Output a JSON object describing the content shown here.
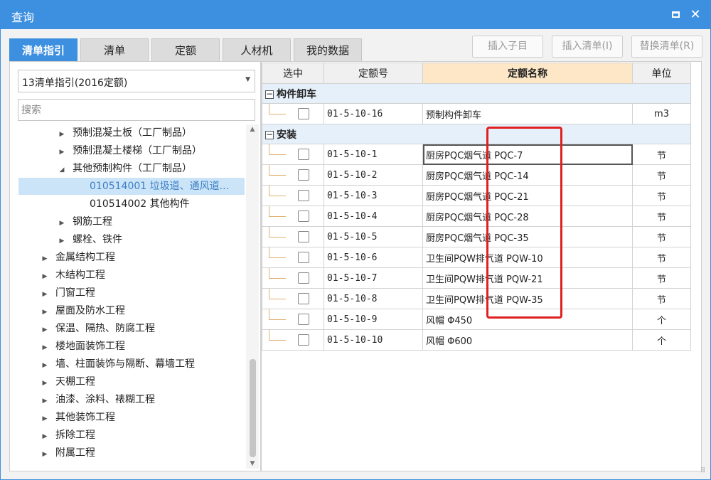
{
  "window": {
    "title": "查询"
  },
  "tabs": [
    {
      "label": "清单指引",
      "active": true
    },
    {
      "label": "清单",
      "active": false
    },
    {
      "label": "定额",
      "active": false
    },
    {
      "label": "人材机",
      "active": false
    },
    {
      "label": "我的数据",
      "active": false
    }
  ],
  "toolbar": {
    "insert_child": "插入子目",
    "insert_list": "插入清单(I)",
    "replace_list": "替换清单(R)"
  },
  "left": {
    "dropdown_value": "13清单指引(2016定额)",
    "search_placeholder": "搜索",
    "tree": [
      {
        "label": "预制混凝土板（工厂制品）",
        "level": 1,
        "expanded": false
      },
      {
        "label": "预制混凝土楼梯（工厂制品）",
        "level": 1,
        "expanded": false
      },
      {
        "label": "其他预制构件（工厂制品）",
        "level": 1,
        "expanded": true
      },
      {
        "label": "010514001  垃圾道、通风道...",
        "level": 2,
        "selected": true
      },
      {
        "label": "010514002  其他构件",
        "level": 2
      },
      {
        "label": "钢筋工程",
        "level": 1,
        "expanded": false
      },
      {
        "label": "螺栓、铁件",
        "level": 1,
        "expanded": false
      },
      {
        "label": "金属结构工程",
        "level": 0,
        "expanded": false
      },
      {
        "label": "木结构工程",
        "level": 0,
        "expanded": false
      },
      {
        "label": "门窗工程",
        "level": 0,
        "expanded": false
      },
      {
        "label": "屋面及防水工程",
        "level": 0,
        "expanded": false
      },
      {
        "label": "保温、隔热、防腐工程",
        "level": 0,
        "expanded": false
      },
      {
        "label": "楼地面装饰工程",
        "level": 0,
        "expanded": false
      },
      {
        "label": "墙、柱面装饰与隔断、幕墙工程",
        "level": 0,
        "expanded": false
      },
      {
        "label": "天棚工程",
        "level": 0,
        "expanded": false
      },
      {
        "label": "油漆、涂料、裱糊工程",
        "level": 0,
        "expanded": false
      },
      {
        "label": "其他装饰工程",
        "level": 0,
        "expanded": false
      },
      {
        "label": "拆除工程",
        "level": 0,
        "expanded": false
      },
      {
        "label": "附属工程",
        "level": 0,
        "expanded": false
      }
    ]
  },
  "grid": {
    "headers": {
      "select": "选中",
      "code": "定额号",
      "name": "定额名称",
      "unit": "单位"
    },
    "groups": [
      {
        "label": "构件卸车",
        "rows": [
          {
            "code": "01-5-10-16",
            "name": "预制构件卸车",
            "unit": "m3"
          }
        ]
      },
      {
        "label": "安装",
        "rows": [
          {
            "code": "01-5-10-1",
            "name": "厨房PQC烟气道 PQC-7",
            "unit": "节"
          },
          {
            "code": "01-5-10-2",
            "name": "厨房PQC烟气道 PQC-14",
            "unit": "节"
          },
          {
            "code": "01-5-10-3",
            "name": "厨房PQC烟气道 PQC-21",
            "unit": "节"
          },
          {
            "code": "01-5-10-4",
            "name": "厨房PQC烟气道 PQC-28",
            "unit": "节"
          },
          {
            "code": "01-5-10-5",
            "name": "厨房PQC烟气道 PQC-35",
            "unit": "节"
          },
          {
            "code": "01-5-10-6",
            "name": "卫生间PQW排气道 PQW-10",
            "unit": "节"
          },
          {
            "code": "01-5-10-7",
            "name": "卫生间PQW排气道 PQW-21",
            "unit": "节"
          },
          {
            "code": "01-5-10-8",
            "name": "卫生间PQW排气道 PQW-35",
            "unit": "节"
          },
          {
            "code": "01-5-10-9",
            "name": "风帽 Φ450",
            "unit": "个"
          },
          {
            "code": "01-5-10-10",
            "name": "风帽 Φ600",
            "unit": "个"
          }
        ]
      }
    ]
  },
  "colors": {
    "accent": "#3d8fe0",
    "highlight_header": "#fde7c7",
    "annotation": "#e02020"
  }
}
